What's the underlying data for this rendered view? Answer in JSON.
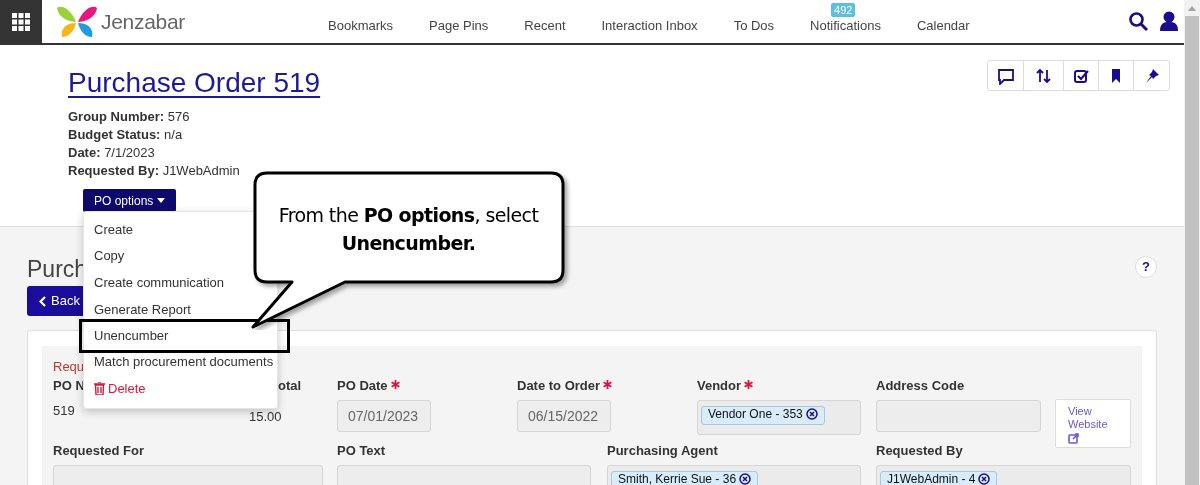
{
  "app_bar": {
    "brand": "Jenzabar",
    "nav": [
      {
        "label": "Bookmarks"
      },
      {
        "label": "Page Pins"
      },
      {
        "label": "Recent"
      },
      {
        "label": "Interaction Inbox"
      },
      {
        "label": "To Dos"
      },
      {
        "label": "Notifications",
        "badge": "492"
      },
      {
        "label": "Calendar"
      }
    ]
  },
  "header": {
    "title": "Purchase Order 519",
    "details": [
      {
        "label": "Group Number:",
        "value": "576"
      },
      {
        "label": "Budget Status:",
        "value": "n/a"
      },
      {
        "label": "Date:",
        "value": "7/1/2023"
      },
      {
        "label": "Requested By:",
        "value": "J1WebAdmin"
      }
    ],
    "options_button": "PO options"
  },
  "options_menu": {
    "items": [
      {
        "label": "Create",
        "kind": "plain",
        "highlighted": false
      },
      {
        "label": "Copy",
        "kind": "plain",
        "highlighted": false
      },
      {
        "label": "Create communication",
        "kind": "plain",
        "highlighted": false
      },
      {
        "label": "Generate Report",
        "kind": "plain",
        "highlighted": false
      },
      {
        "label": "Unencumber",
        "kind": "plain",
        "highlighted": true
      },
      {
        "label": "Match procurement documents",
        "kind": "plain",
        "highlighted": false
      },
      {
        "label": "Delete",
        "kind": "danger",
        "highlighted": false
      }
    ]
  },
  "callout": {
    "text": "From the **PO options**, select **Unencumber.**"
  },
  "section": {
    "title": "Purch",
    "back_button": "Back",
    "help": "?"
  },
  "form": {
    "required_note": "Requ",
    "row_1": [
      {
        "kind": "static",
        "label": "PO N",
        "value": "519",
        "required": false
      },
      {
        "kind": "static",
        "label": "otal",
        "value": "15.00",
        "required": false
      },
      {
        "kind": "input",
        "label": "PO Date",
        "value": "07/01/2023",
        "required": true
      },
      {
        "kind": "input",
        "label": "Date to Order",
        "value": "06/15/2022",
        "required": true
      },
      {
        "kind": "chips",
        "label": "Vendor",
        "chips": [
          "Vendor One - 353"
        ],
        "required": true
      },
      {
        "kind": "input",
        "label": "Address Code",
        "required": false
      },
      {
        "kind": "link_button",
        "label": "View Website"
      }
    ],
    "row_2": [
      {
        "kind": "input",
        "label": "Requested For",
        "required": false
      },
      {
        "kind": "input",
        "label": "PO Text",
        "required": false
      },
      {
        "kind": "chips",
        "label": "Purchasing Agent",
        "chips": [
          "Smith, Kerrie Sue - 36"
        ],
        "required": false
      },
      {
        "kind": "chips",
        "label": "Requested By",
        "chips": [
          "J1WebAdmin - 4"
        ],
        "required": false
      }
    ]
  }
}
